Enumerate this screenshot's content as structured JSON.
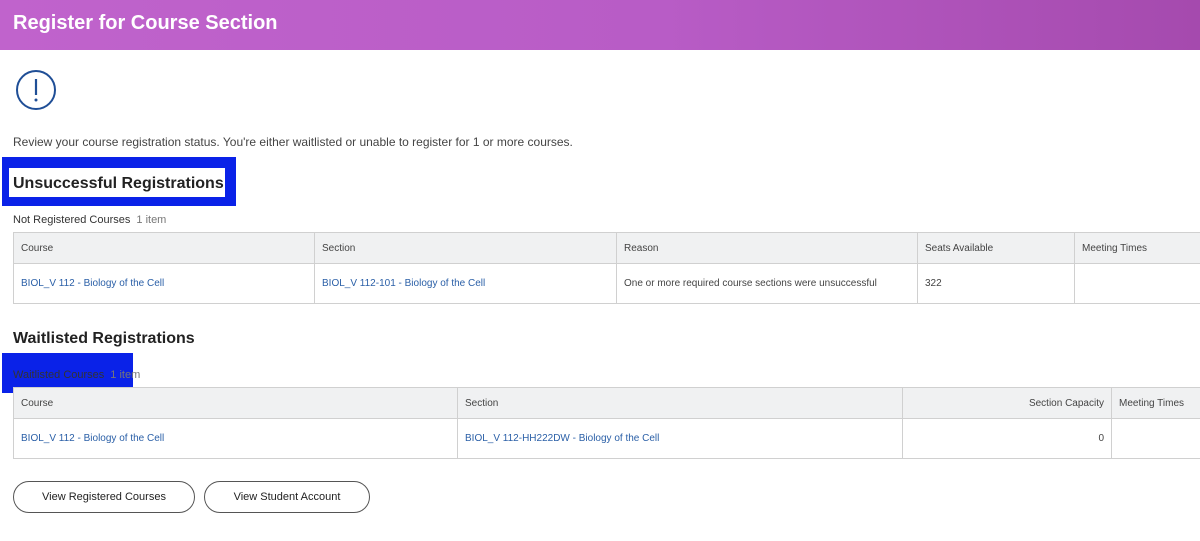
{
  "header": {
    "title": "Register for Course Section"
  },
  "icons": {
    "alert": "exclamation-circle-icon"
  },
  "intro_text": "Review your course registration status. You're either waitlisted or unable to register for 1 or more courses.",
  "unsuccessful": {
    "heading": "Unsuccessful Registrations",
    "grid_title": "Not Registered Courses",
    "grid_count": "1 item",
    "columns": [
      "Course",
      "Section",
      "Reason",
      "Seats Available",
      "Meeting Times"
    ],
    "rows": [
      {
        "course": "BIOL_V 112 - Biology of the Cell",
        "section": "BIOL_V 112-101 - Biology of the Cell",
        "reason": "One or more required course sections were unsuccessful",
        "seats_available": "322",
        "meeting_times": ""
      }
    ]
  },
  "waitlisted": {
    "heading": "Waitlisted Registrations",
    "grid_title": "Waitlisted Courses",
    "grid_count": "1 item",
    "columns": [
      "Course",
      "Section",
      "Section Capacity",
      "Meeting Times"
    ],
    "rows": [
      {
        "course": "BIOL_V 112 - Biology of the Cell",
        "section": "BIOL_V 112-HH222DW - Biology of the Cell",
        "section_capacity": "0",
        "meeting_times": ""
      }
    ]
  },
  "buttons": {
    "view_registered": "View Registered Courses",
    "view_account": "View Student Account"
  },
  "colors": {
    "header_gradient_start": "#c063cc",
    "header_gradient_end": "#a54aae",
    "link": "#2a5fa7",
    "highlight": "#0a22e8",
    "icon": "#1f4e96"
  }
}
